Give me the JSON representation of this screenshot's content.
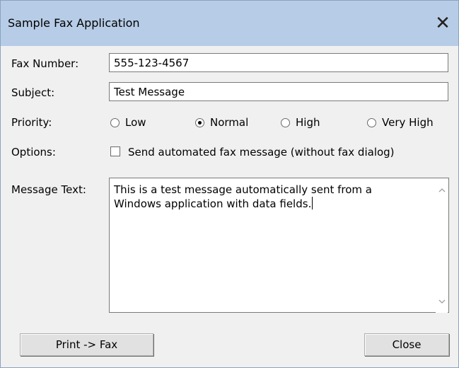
{
  "window": {
    "title": "Sample Fax Application",
    "close_glyph": "✕"
  },
  "form": {
    "fax_number_label": "Fax Number:",
    "fax_number_value": "555-123-4567",
    "subject_label": "Subject:",
    "subject_value": "Test Message",
    "priority_label": "Priority:",
    "priority_options": [
      "Low",
      "Normal",
      "High",
      "Very High"
    ],
    "priority_selected": "Normal",
    "options_label": "Options:",
    "option_checkbox_label": "Send automated fax message (without fax dialog)",
    "option_checked": false,
    "message_label": "Message Text:",
    "message_value": "This is a test message automatically sent from a\nWindows application with data fields."
  },
  "buttons": {
    "print_fax": "Print -> Fax",
    "close": "Close"
  },
  "icons": {
    "close": "close-icon",
    "scroll_up": "chevron-up-icon",
    "scroll_down": "chevron-down-icon"
  }
}
